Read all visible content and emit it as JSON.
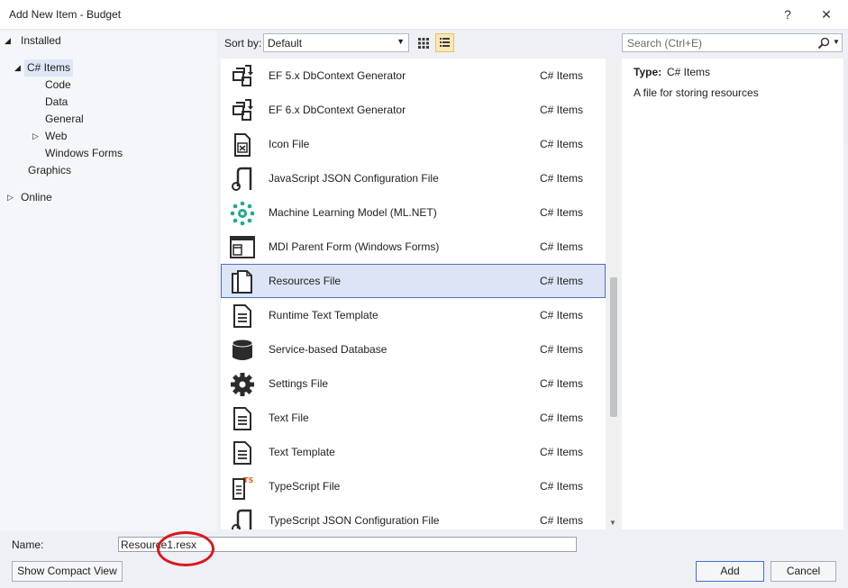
{
  "window": {
    "title": "Add New Item - Budget",
    "help": "?",
    "close": "✕"
  },
  "tree": {
    "installed": "Installed",
    "csharp_items": "C# Items",
    "children": [
      "Code",
      "Data",
      "General",
      "Web",
      "Windows Forms"
    ],
    "graphics": "Graphics",
    "online": "Online"
  },
  "toolbar": {
    "sort_label": "Sort by:",
    "sort_value": "Default",
    "search_placeholder": "Search (Ctrl+E)"
  },
  "items": [
    {
      "name": "EF 5.x DbContext Generator",
      "category": "C# Items",
      "icon": "ef-generator-icon"
    },
    {
      "name": "EF 6.x DbContext Generator",
      "category": "C# Items",
      "icon": "ef-generator-icon"
    },
    {
      "name": "Icon File",
      "category": "C# Items",
      "icon": "icon-file-icon"
    },
    {
      "name": "JavaScript JSON Configuration File",
      "category": "C# Items",
      "icon": "json-config-icon"
    },
    {
      "name": "Machine Learning Model (ML.NET)",
      "category": "C# Items",
      "icon": "ml-model-icon"
    },
    {
      "name": "MDI Parent Form (Windows Forms)",
      "category": "C# Items",
      "icon": "mdi-form-icon"
    },
    {
      "name": "Resources File",
      "category": "C# Items",
      "icon": "resources-file-icon",
      "selected": true
    },
    {
      "name": "Runtime Text Template",
      "category": "C# Items",
      "icon": "text-template-icon"
    },
    {
      "name": "Service-based Database",
      "category": "C# Items",
      "icon": "database-icon"
    },
    {
      "name": "Settings File",
      "category": "C# Items",
      "icon": "settings-gear-icon"
    },
    {
      "name": "Text File",
      "category": "C# Items",
      "icon": "text-file-icon"
    },
    {
      "name": "Text Template",
      "category": "C# Items",
      "icon": "text-template-icon"
    },
    {
      "name": "TypeScript File",
      "category": "C# Items",
      "icon": "typescript-file-icon"
    },
    {
      "name": "TypeScript JSON Configuration File",
      "category": "C# Items",
      "icon": "json-config-icon"
    }
  ],
  "detail": {
    "type_label": "Type:",
    "type_value": "C# Items",
    "description": "A file for storing resources"
  },
  "bottom": {
    "name_label": "Name:",
    "name_value": "Resource1.resx",
    "compact_view": "Show Compact View",
    "add": "Add",
    "cancel": "Cancel"
  },
  "colors": {
    "selection": "#dde4f6",
    "selection_border": "#4f6fbf",
    "annotation": "#d71920",
    "ml_icon": "#1fa98a",
    "typescript_badge": "#e05a1c"
  }
}
